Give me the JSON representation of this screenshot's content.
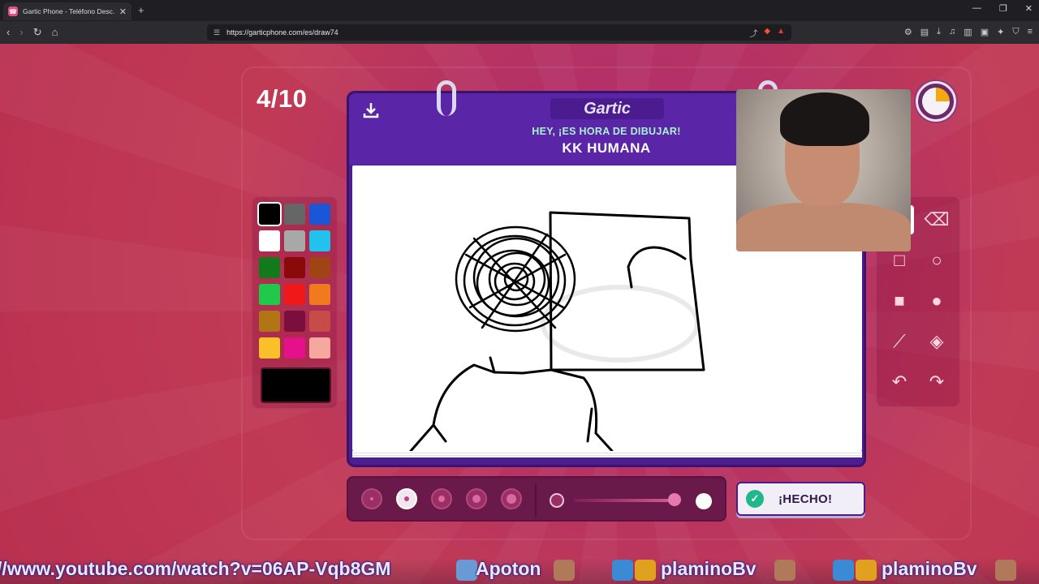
{
  "browser": {
    "tab_title": "Gartic Phone - Teléfono Desc...",
    "url": "https://garticphone.com/es/draw74"
  },
  "game": {
    "round": "4/10",
    "logo": "Gartic",
    "subtitle": "HEY, ¡ES HORA DE DIBUJAR!",
    "prompt": "KK HUMANA",
    "timer_remaining_fraction": 0.25,
    "done_label": "¡HECHO!"
  },
  "palette": {
    "colors": [
      "#000000",
      "#666666",
      "#1a56d6",
      "#ffffff",
      "#a8a8a8",
      "#22c2ee",
      "#137a1b",
      "#8a0a0a",
      "#a04416",
      "#20c94a",
      "#f01818",
      "#f07a1d",
      "#b27515",
      "#7a0f3e",
      "#c74b48",
      "#f8c12a",
      "#e4118a",
      "#f6a7a0"
    ],
    "selected": "#000000",
    "current": "#000000"
  },
  "tools": [
    "pen-icon",
    "eraser-icon",
    "rect-outline-icon",
    "circle-outline-icon",
    "rect-fill-icon",
    "circle-fill-icon",
    "line-icon",
    "fill-bucket-icon",
    "undo-icon",
    "redo-icon"
  ],
  "brush": {
    "sizes": [
      1,
      2,
      3,
      4,
      5
    ],
    "selected_index": 1,
    "opacity_fraction": 0.95
  },
  "ticker": {
    "link": "//www.youtube.com/watch?v=06AP-Vqb8GM",
    "user1": "Apoton",
    "user2": "plaminoBv",
    "user3": "plaminoBv"
  }
}
